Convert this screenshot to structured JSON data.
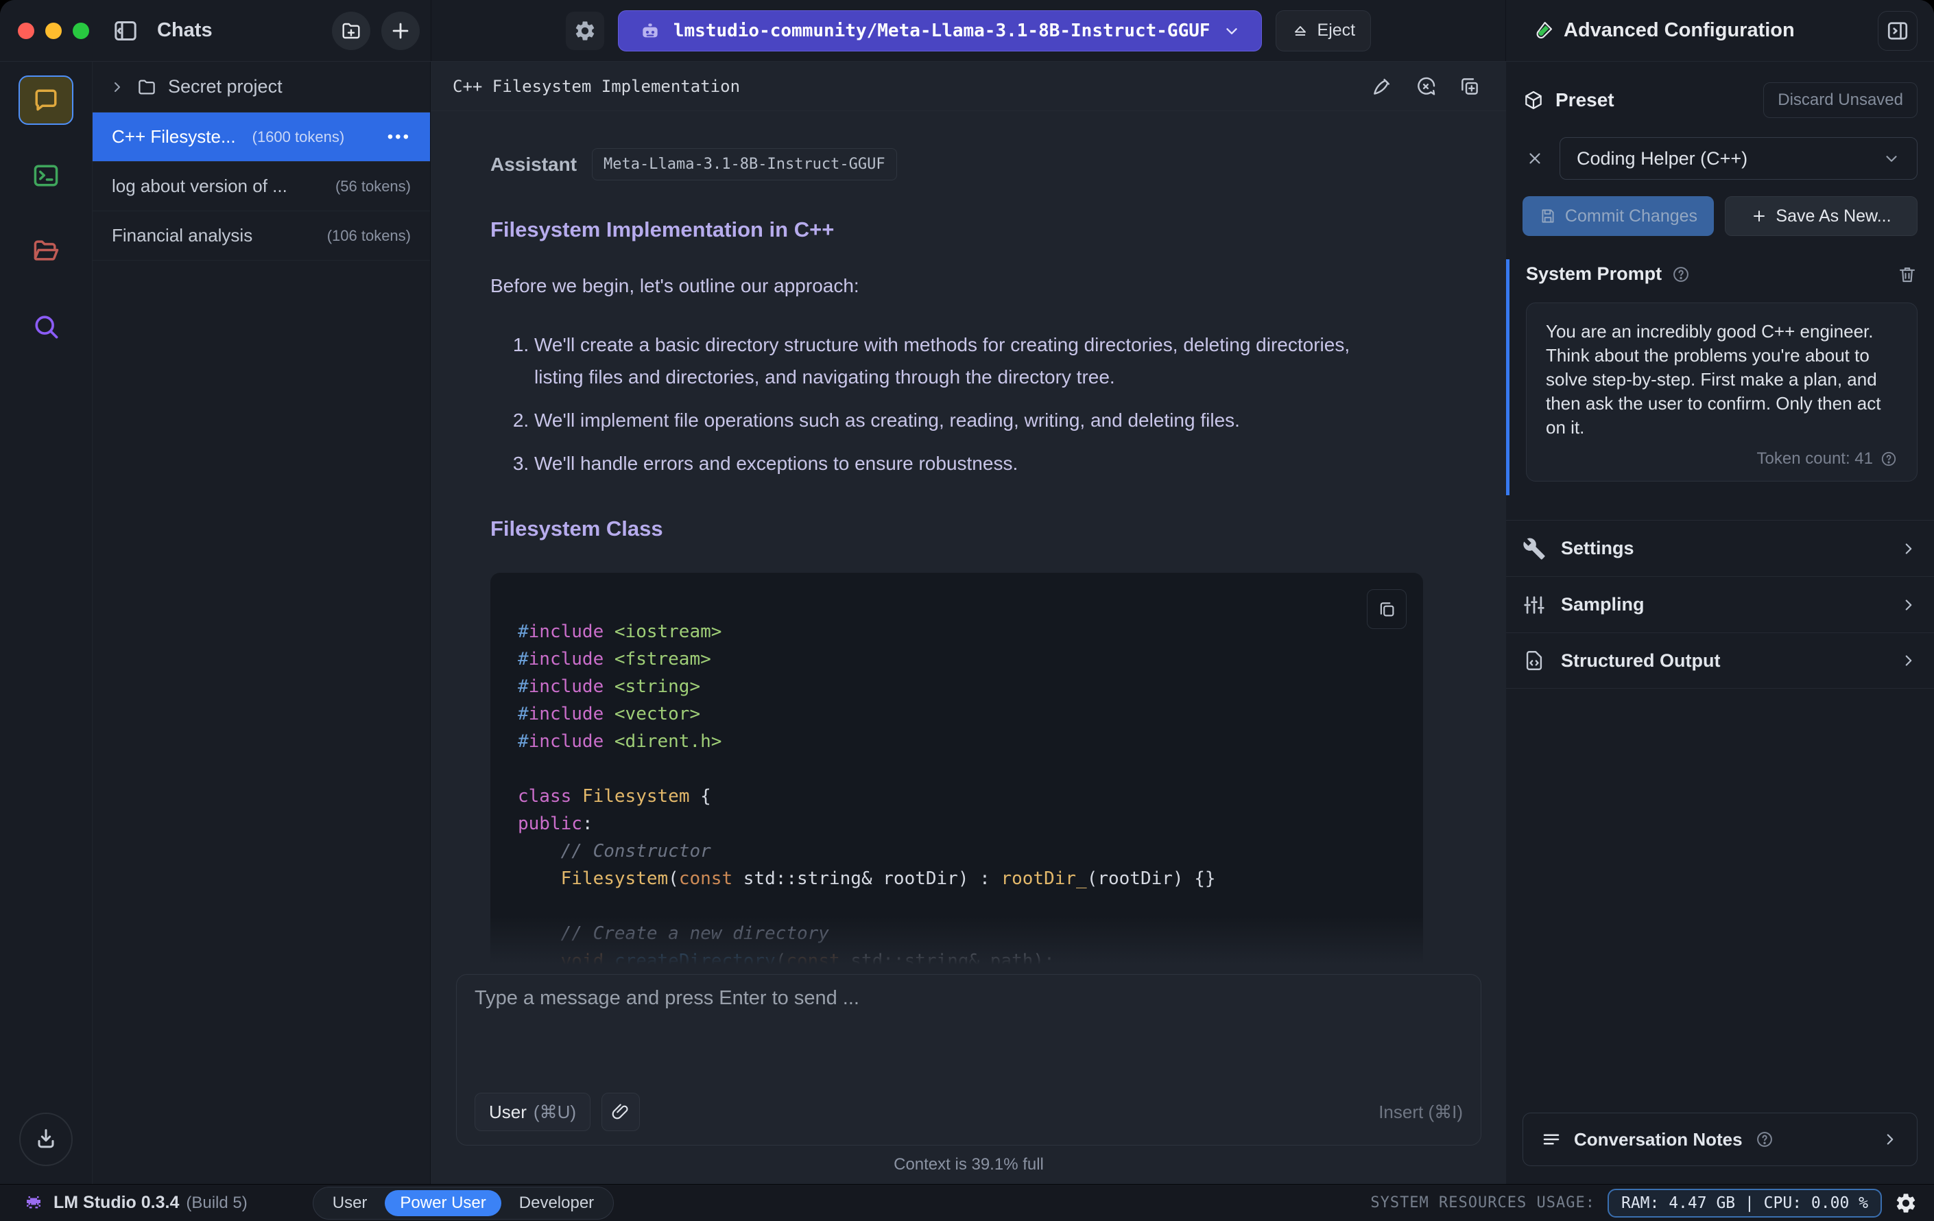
{
  "window": {
    "sidebar_header": {
      "title": "Chats"
    },
    "model_bar": {
      "model": "lmstudio-community/Meta-Llama-3.1-8B-Instruct-GGUF",
      "eject_label": "Eject"
    },
    "right_header": {
      "title": "Advanced Configuration"
    }
  },
  "sidebar": {
    "folder": {
      "name": "Secret project"
    },
    "chats": [
      {
        "title": "C++ Filesyste...",
        "tokens": "(1600 tokens)",
        "selected": true,
        "menu_dots": "•••"
      },
      {
        "title": "log about version of ...",
        "tokens": "(56 tokens)",
        "selected": false
      },
      {
        "title": "Financial analysis",
        "tokens": "(106 tokens)",
        "selected": false
      }
    ]
  },
  "chat": {
    "title": "C++ Filesystem Implementation",
    "assistant_label": "Assistant",
    "model_badge": "Meta-Llama-3.1-8B-Instruct-GGUF",
    "heading1": "Filesystem Implementation in C++",
    "intro": "Before we begin, let's outline our approach:",
    "approach": [
      "We'll create a basic directory structure with methods for creating directories, deleting directories, listing files and directories, and navigating through the directory tree.",
      "We'll implement file operations such as creating, reading, writing, and deleting files.",
      "We'll handle errors and exceptions to ensure robustness."
    ],
    "heading2": "Filesystem Class",
    "code_lines": [
      [
        {
          "c": "hash",
          "t": "#"
        },
        {
          "c": "kw",
          "t": "include"
        },
        {
          "c": "plain",
          "t": " "
        },
        {
          "c": "hdr",
          "t": "<iostream>"
        }
      ],
      [
        {
          "c": "hash",
          "t": "#"
        },
        {
          "c": "kw",
          "t": "include"
        },
        {
          "c": "plain",
          "t": " "
        },
        {
          "c": "hdr",
          "t": "<fstream>"
        }
      ],
      [
        {
          "c": "hash",
          "t": "#"
        },
        {
          "c": "kw",
          "t": "include"
        },
        {
          "c": "plain",
          "t": " "
        },
        {
          "c": "hdr",
          "t": "<string>"
        }
      ],
      [
        {
          "c": "hash",
          "t": "#"
        },
        {
          "c": "kw",
          "t": "include"
        },
        {
          "c": "plain",
          "t": " "
        },
        {
          "c": "hdr",
          "t": "<vector>"
        }
      ],
      [
        {
          "c": "hash",
          "t": "#"
        },
        {
          "c": "kw",
          "t": "include"
        },
        {
          "c": "plain",
          "t": " "
        },
        {
          "c": "hdr",
          "t": "<dirent.h>"
        }
      ],
      [],
      [
        {
          "c": "kw",
          "t": "class"
        },
        {
          "c": "plain",
          "t": " "
        },
        {
          "c": "type",
          "t": "Filesystem"
        },
        {
          "c": "plain",
          "t": " {"
        }
      ],
      [
        {
          "c": "kw",
          "t": "public"
        },
        {
          "c": "plain",
          "t": ":"
        }
      ],
      [
        {
          "c": "plain",
          "t": "    "
        },
        {
          "c": "com",
          "t": "// Constructor"
        }
      ],
      [
        {
          "c": "plain",
          "t": "    "
        },
        {
          "c": "type",
          "t": "Filesystem"
        },
        {
          "c": "plain",
          "t": "("
        },
        {
          "c": "kw2",
          "t": "const"
        },
        {
          "c": "plain",
          "t": " std::string& rootDir) : "
        },
        {
          "c": "type",
          "t": "rootDir_"
        },
        {
          "c": "plain",
          "t": "(rootDir) {}"
        }
      ],
      [],
      [
        {
          "c": "plain",
          "t": "    "
        },
        {
          "c": "com",
          "t": "// Create a new directory"
        }
      ],
      [
        {
          "c": "plain",
          "t": "    "
        },
        {
          "c": "kw2",
          "t": "void"
        },
        {
          "c": "plain",
          "t": " "
        },
        {
          "c": "fn",
          "t": "createDirectory"
        },
        {
          "c": "plain",
          "t": "("
        },
        {
          "c": "kw2",
          "t": "const"
        },
        {
          "c": "plain",
          "t": " std::string& path);"
        }
      ]
    ],
    "input_placeholder": "Type a message and press Enter to send ...",
    "user_button": "User",
    "user_shortcut": "(⌘U)",
    "insert_label": "Insert (⌘I)",
    "context_status": "Context is 39.1% full"
  },
  "panel": {
    "preset": {
      "label": "Preset",
      "discard": "Discard Unsaved",
      "selected": "Coding Helper (C++)",
      "commit": "Commit Changes",
      "save_new": "Save As New..."
    },
    "system_prompt": {
      "label": "System Prompt",
      "text": "You are an incredibly good C++ engineer. Think about the problems you're about to solve step-by-step. First make a plan, and then ask the user to confirm. Only then act on it.",
      "token_count": "Token count: 41"
    },
    "sections": [
      {
        "label": "Settings",
        "icon": "wrench-icon"
      },
      {
        "label": "Sampling",
        "icon": "sliders-icon"
      },
      {
        "label": "Structured Output",
        "icon": "file-code-icon"
      }
    ],
    "notes": {
      "label": "Conversation Notes"
    }
  },
  "statusbar": {
    "app_name": "LM Studio 0.3.4",
    "build": "(Build 5)",
    "modes": [
      {
        "label": "User",
        "active": false
      },
      {
        "label": "Power User",
        "active": true
      },
      {
        "label": "Developer",
        "active": false
      }
    ],
    "resources_label": "SYSTEM RESOURCES USAGE:",
    "resources_value": "RAM: 4.47 GB | CPU: 0.00 %"
  },
  "colors": {
    "accent_blue": "#3b82f6",
    "selected_row": "#2e6be5",
    "model_pill": "#4a45c2"
  }
}
